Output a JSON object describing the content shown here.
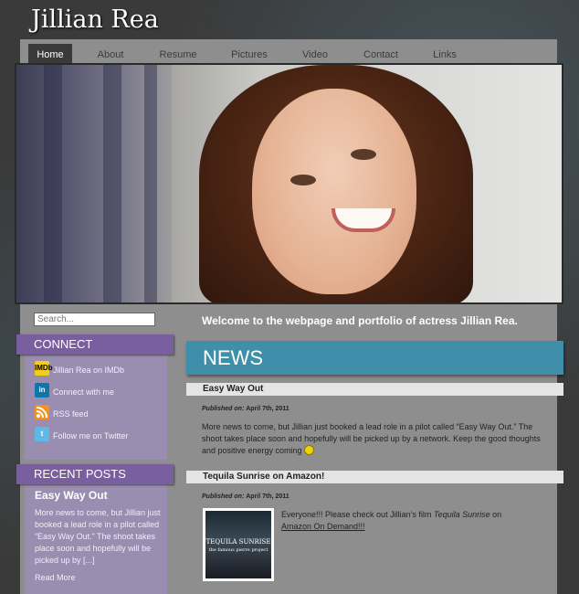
{
  "site": {
    "title": "Jillian Rea"
  },
  "nav": {
    "items": [
      {
        "label": "Home",
        "active": true
      },
      {
        "label": "About"
      },
      {
        "label": "Resume"
      },
      {
        "label": "Pictures"
      },
      {
        "label": "Video"
      },
      {
        "label": "Contact"
      },
      {
        "label": "Links"
      }
    ]
  },
  "search": {
    "placeholder": "Search..."
  },
  "welcome": "Welcome to the webpage and portfolio of actress Jillian Rea.",
  "sidebar": {
    "connect_title": "CONNECT",
    "connect_items": [
      {
        "label": "Jillian Rea on IMDb",
        "icon": "imdb-icon",
        "icon_text": "IMDb",
        "color": "#f3ce13"
      },
      {
        "label": "Connect with me",
        "icon": "linkedin-icon",
        "icon_text": "in",
        "color": "#0e76a8"
      },
      {
        "label": "RSS feed",
        "icon": "rss-icon",
        "icon_text": "",
        "color": "#f39220"
      },
      {
        "label": "Follow me on Twitter",
        "icon": "twitter-icon",
        "icon_text": "t",
        "color": "#5fb9e8"
      }
    ],
    "recent_title": "RECENT POSTS",
    "recent_post": {
      "title": "Easy Way Out",
      "excerpt": "More news to come, but Jillian just booked a lead role in a pilot called “Easy Way Out.” The shoot takes place soon and hopefully will be picked up by [...]",
      "read_more": "Read More"
    }
  },
  "news": {
    "title": "NEWS",
    "posts": [
      {
        "title": "Easy Way Out",
        "meta_prefix": "Published on:",
        "date": "April 7th, 2011",
        "body": "More news to come, but Jillian just booked a lead role in a pilot called “Easy Way Out.”  The shoot takes place soon and hopefully will be picked up by a network.  Keep the good thoughts and positive energy coming "
      },
      {
        "title": "Tequila Sunrise on Amazon!",
        "meta_prefix": "Published on:",
        "date": "April 7th, 2011",
        "body_before": "Everyone!!! Please check out Jillian’s film ",
        "body_em": "Tequila Sunrise",
        "body_after": " on ",
        "link": "Amazon On Demand!!!",
        "cover": {
          "title": "TEQUILA SUNRISE",
          "subtitle": "the famous pierre project"
        }
      }
    ]
  },
  "colors": {
    "accent_purple": "#7a5fa0",
    "accent_blue": "#3f8eaa",
    "panel_gray": "#8e8e8e"
  }
}
